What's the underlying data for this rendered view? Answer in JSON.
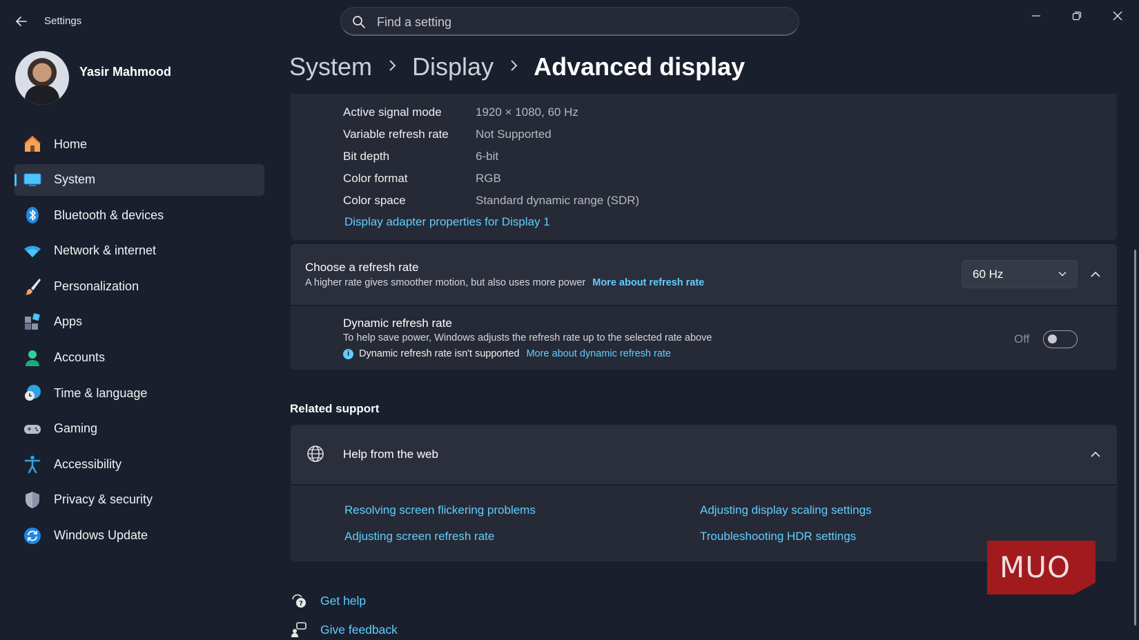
{
  "app": {
    "title": "Settings"
  },
  "search": {
    "placeholder": "Find a setting"
  },
  "profile": {
    "name": "Yasir Mahmood"
  },
  "sidebar": {
    "items": [
      {
        "label": "Home",
        "icon": "home-icon"
      },
      {
        "label": "System",
        "icon": "system-icon",
        "active": true
      },
      {
        "label": "Bluetooth & devices",
        "icon": "bluetooth-icon"
      },
      {
        "label": "Network & internet",
        "icon": "wifi-icon"
      },
      {
        "label": "Personalization",
        "icon": "brush-icon"
      },
      {
        "label": "Apps",
        "icon": "apps-icon"
      },
      {
        "label": "Accounts",
        "icon": "accounts-icon"
      },
      {
        "label": "Time & language",
        "icon": "time-language-icon"
      },
      {
        "label": "Gaming",
        "icon": "gamepad-icon"
      },
      {
        "label": "Accessibility",
        "icon": "accessibility-icon"
      },
      {
        "label": "Privacy & security",
        "icon": "shield-icon"
      },
      {
        "label": "Windows Update",
        "icon": "windows-update-icon"
      }
    ]
  },
  "breadcrumb": {
    "items": [
      "System",
      "Display"
    ],
    "current": "Advanced display"
  },
  "display_info": {
    "rows": [
      {
        "key": "Active signal mode",
        "value": "1920 × 1080, 60 Hz"
      },
      {
        "key": "Variable refresh rate",
        "value": "Not Supported"
      },
      {
        "key": "Bit depth",
        "value": "6-bit"
      },
      {
        "key": "Color format",
        "value": "RGB"
      },
      {
        "key": "Color space",
        "value": "Standard dynamic range (SDR)"
      }
    ],
    "adapter_link": "Display adapter properties for Display 1"
  },
  "refresh_rate": {
    "title": "Choose a refresh rate",
    "description": "A higher rate gives smoother motion, but also uses more power",
    "link": "More about refresh rate",
    "selected": "60 Hz"
  },
  "dynamic_refresh": {
    "title": "Dynamic refresh rate",
    "description": "To help save power, Windows adjusts the refresh rate up to the selected rate above",
    "note": "Dynamic refresh rate isn't supported",
    "note_link": "More about dynamic refresh rate",
    "toggle_label": "Off",
    "toggle_on": false
  },
  "related_support": {
    "heading": "Related support",
    "help_title": "Help from the web",
    "links": [
      "Resolving screen flickering problems",
      "Adjusting display scaling settings",
      "Adjusting screen refresh rate",
      "Troubleshooting HDR settings"
    ]
  },
  "footer": {
    "get_help": "Get help",
    "give_feedback": "Give feedback"
  },
  "watermark": {
    "text": "MUO"
  },
  "colors": {
    "background": "#1a1f2e",
    "card": "#262a36",
    "accent": "#60cdff",
    "watermark": "#a01a1e"
  }
}
